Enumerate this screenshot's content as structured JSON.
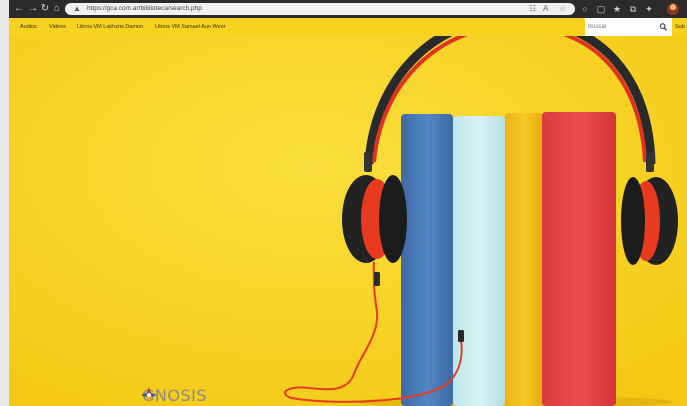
{
  "browser": {
    "url": "https://gca.com.ar/biblioteca/search.php",
    "icons": {
      "back": "arrow-left",
      "forward": "arrow-right",
      "reload": "reload",
      "home": "home",
      "lock": "lock",
      "extensions": "puzzle"
    }
  },
  "nav": {
    "items": [
      {
        "label": "Audios"
      },
      {
        "label": "Videos"
      },
      {
        "label": "Libros VM Lakhsmi Damon"
      },
      {
        "label": "Libros VM Samael Aun Weor"
      }
    ]
  },
  "search": {
    "placeholder": "Buscar",
    "submit_label": "Sub"
  },
  "brand": {
    "name": "GNOSIS"
  },
  "colors": {
    "background": "#f7d21f",
    "book_blue": "#4a78b4",
    "book_light": "#c8eef0",
    "book_yellow": "#f4c21a",
    "book_red": "#e84444",
    "headphone_red": "#e83a1f",
    "headphone_dark": "#2a2a2a"
  }
}
